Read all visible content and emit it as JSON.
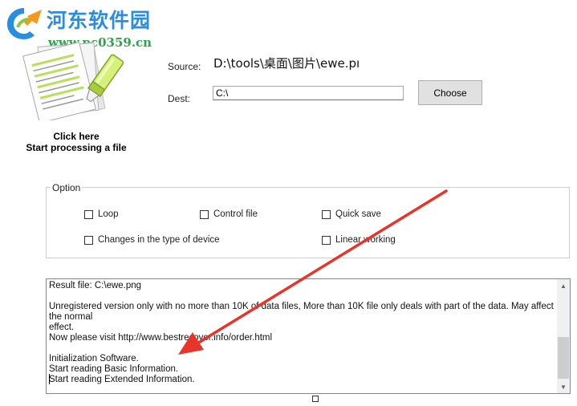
{
  "watermark": {
    "title": "河东软件园",
    "url": "www.pc0359.cn"
  },
  "process": {
    "icon": "highlighter-document-icon",
    "line1": "Click here",
    "line2": "Start processing a file"
  },
  "source": {
    "label": "Source:",
    "value": "D:\\tools\\桌面\\图片\\ewe.pı"
  },
  "dest": {
    "label": "Dest:",
    "value": "C:\\"
  },
  "choose_button": "Choose",
  "options": {
    "legend": "Option",
    "items": [
      {
        "label": "Loop",
        "checked": false
      },
      {
        "label": "Control file",
        "checked": false
      },
      {
        "label": "Quick save",
        "checked": false
      },
      {
        "label": "Changes in the type of device",
        "checked": false
      },
      {
        "label": "Linear working",
        "checked": false
      }
    ]
  },
  "log": {
    "lines": [
      "Result file: C:\\ewe.png",
      "",
      "Unregistered version only with no more than 10K of data files, More than 10K file only deals with part of the data. May affect the normal",
      "effect.",
      "Now please visit http://www.bestrecover.info/order.html",
      "",
      "Initialization Software.",
      "Start reading Basic Information.",
      "Start reading Extended Information."
    ]
  },
  "annotation": {
    "arrow_color": "#e8342a"
  }
}
